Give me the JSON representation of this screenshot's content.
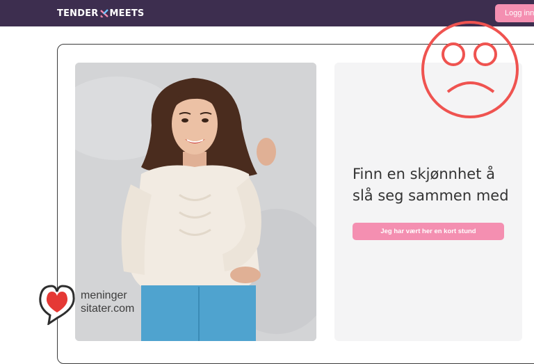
{
  "header": {
    "logo_left": "TENDER",
    "logo_right": "MEETS",
    "login_label": "Logg inn"
  },
  "hero": {
    "headline": "Finn en skjønnhet å slå seg sammen med",
    "cta_label": "Jeg har vært her en kort stund"
  },
  "watermark": {
    "line1": "meninger",
    "line2": "sitater.com"
  },
  "colors": {
    "header_bg": "#3d2e4f",
    "accent_pink": "#f48fb1",
    "sad_face_red": "#ef5350",
    "panel_bg": "#f4f4f5"
  },
  "icons": {
    "logo_mark": "heart-x-mark",
    "overlay": "sad-face-icon",
    "watermark": "heart-speech-bubble-icon"
  }
}
